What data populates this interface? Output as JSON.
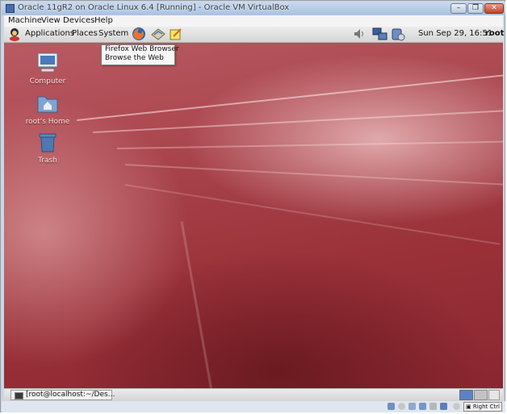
{
  "window": {
    "title": "Oracle 11gR2 on Oracle Linux 6.4 [Running] - Oracle VM VirtualBox",
    "buttons": [
      "minimize",
      "restore",
      "close"
    ]
  },
  "vbox_menu": [
    "Machine",
    "View",
    "Devices",
    "Help"
  ],
  "gnome_panel": {
    "menus": [
      "Applications",
      "Places",
      "System"
    ],
    "launchers": [
      "firefox-icon",
      "mail-icon",
      "notes-icon"
    ],
    "clock": "Sun Sep 29, 16:51",
    "user": "root"
  },
  "tooltip": {
    "line1": "Firefox Web Browser",
    "line2": "Browse the Web"
  },
  "desktop_icons": [
    {
      "label": "Computer",
      "icon": "computer-icon"
    },
    {
      "label": "root's Home",
      "icon": "home-folder-icon"
    },
    {
      "label": "Trash",
      "icon": "trash-icon"
    }
  ],
  "taskbar": {
    "window_button": "[root@localhost:~/Des..."
  },
  "statusbar": {
    "host_key": "Right Ctrl"
  },
  "colors": {
    "desktop_red": "#a8434b",
    "panel_gray": "#e2e2e2",
    "vbox_frame": "#c9d6e6"
  }
}
